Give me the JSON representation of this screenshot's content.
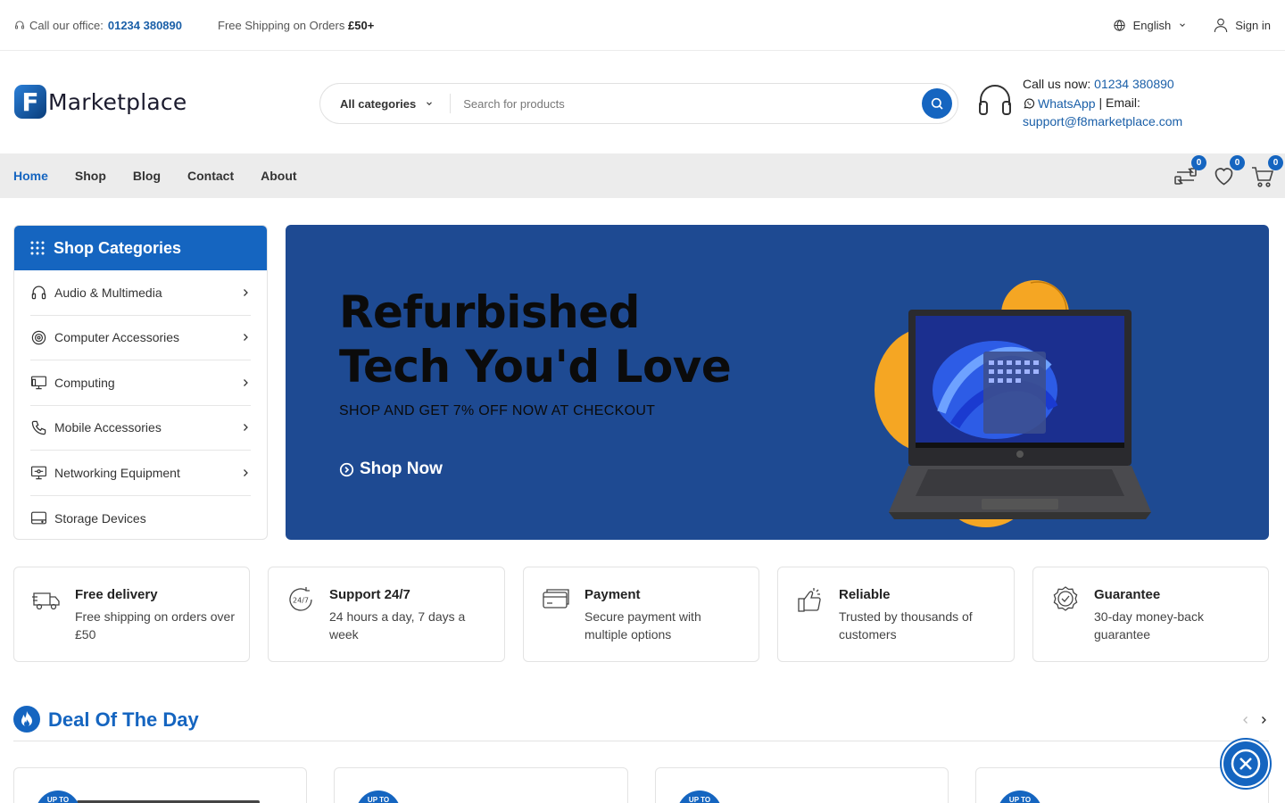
{
  "topbar": {
    "office_label": "Call our office:",
    "office_phone": "01234 380890",
    "shipping_text": "Free Shipping on Orders",
    "shipping_amount": "£50+",
    "language": "English",
    "signin": "Sign in"
  },
  "header": {
    "logo_mark": "F",
    "logo_text": "Marketplace",
    "search": {
      "category": "All categories",
      "placeholder": "Search for products"
    },
    "contact": {
      "call_label": "Call us now:",
      "call_phone": "01234 380890",
      "whatsapp": "WhatsApp",
      "separator": "|",
      "email_label": "Email:",
      "email": "support@f8marketplace.com"
    }
  },
  "nav": {
    "links": [
      "Home",
      "Shop",
      "Blog",
      "Contact",
      "About"
    ],
    "compare_count": "0",
    "wishlist_count": "0",
    "cart_count": "0"
  },
  "categories": {
    "title": "Shop Categories",
    "items": [
      {
        "label": "Audio & Multimedia",
        "icon": "headphones-icon"
      },
      {
        "label": "Computer Accessories",
        "icon": "webcam-icon"
      },
      {
        "label": "Computing",
        "icon": "desktop-icon"
      },
      {
        "label": "Mobile Accessories",
        "icon": "phone-icon"
      },
      {
        "label": "Networking Equipment",
        "icon": "network-icon"
      },
      {
        "label": "Storage Devices",
        "icon": "hard-drive-icon"
      }
    ]
  },
  "hero": {
    "title_line1": "Refurbished",
    "title_line2": "Tech You'd Love",
    "subtitle": "SHOP AND GET 7% OFF NOW AT CHECKOUT",
    "cta": "Shop Now",
    "background": "#1e4a92"
  },
  "features": [
    {
      "title": "Free delivery",
      "desc": "Free shipping on orders over £50",
      "icon": "truck-icon"
    },
    {
      "title": "Support 24/7",
      "desc": "24 hours a day, 7 days a week",
      "icon": "support-24-7-icon"
    },
    {
      "title": "Payment",
      "desc": "Secure payment with multiple options",
      "icon": "credit-card-icon"
    },
    {
      "title": "Reliable",
      "desc": "Trusted by thousands of customers",
      "icon": "thumbs-up-icon"
    },
    {
      "title": "Guarantee",
      "desc": "30-day money-back guarantee",
      "icon": "badge-check-icon"
    }
  ],
  "deal": {
    "title": "Deal Of The Day",
    "badge": "UP TO"
  },
  "colors": {
    "primary": "#1565c0",
    "link": "#1a5fa8",
    "nav_bg": "#ececec",
    "accent_orange": "#f5a623"
  }
}
